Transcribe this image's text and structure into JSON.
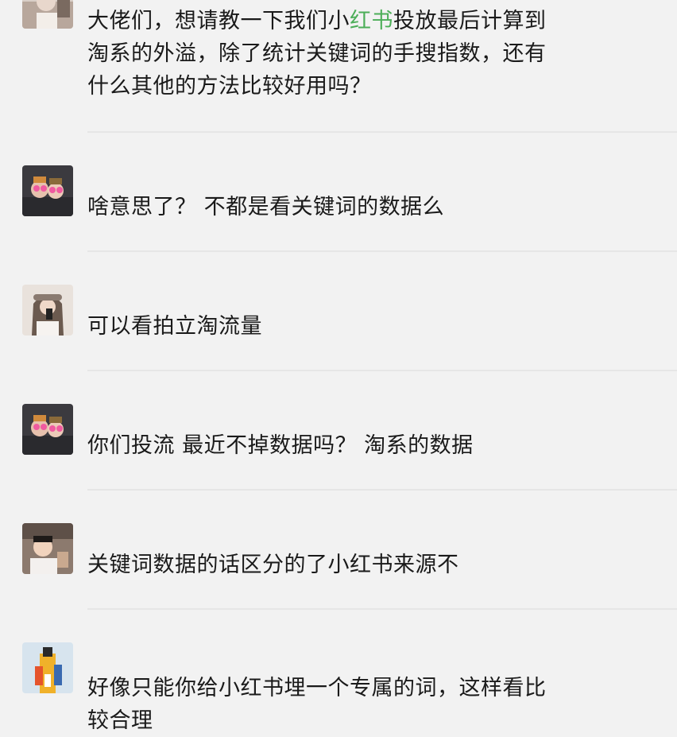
{
  "messages": [
    {
      "text_lines": [
        {
          "before": "大佬们，想请教一下我们小",
          "highlight": "红书",
          "after": "投放最后计算到"
        },
        {
          "before": "淘系的外溢，除了统计关键词的手搜指数，还有",
          "highlight": "",
          "after": ""
        },
        {
          "before": "什么其他的方法比较好用吗？",
          "highlight": "",
          "after": ""
        }
      ],
      "highlight_color": "#4cae58"
    },
    {
      "text_lines": [
        {
          "before": "啥意思了？ 不都是看关键词的数据么",
          "highlight": "",
          "after": ""
        }
      ]
    },
    {
      "text_lines": [
        {
          "before": "可以看拍立淘流量",
          "highlight": "",
          "after": ""
        }
      ]
    },
    {
      "text_lines": [
        {
          "before": "你们投流 最近不掉数据吗？ 淘系的数据",
          "highlight": "",
          "after": ""
        }
      ]
    },
    {
      "text_lines": [
        {
          "before": "关键词数据的话区分的了小红书来源不",
          "highlight": "",
          "after": ""
        }
      ]
    },
    {
      "text_lines": [
        {
          "before": "好像只能你给小红书埋一个专属的词，这样看比",
          "highlight": "",
          "after": ""
        },
        {
          "before": "较合理",
          "highlight": "",
          "after": ""
        }
      ]
    }
  ]
}
